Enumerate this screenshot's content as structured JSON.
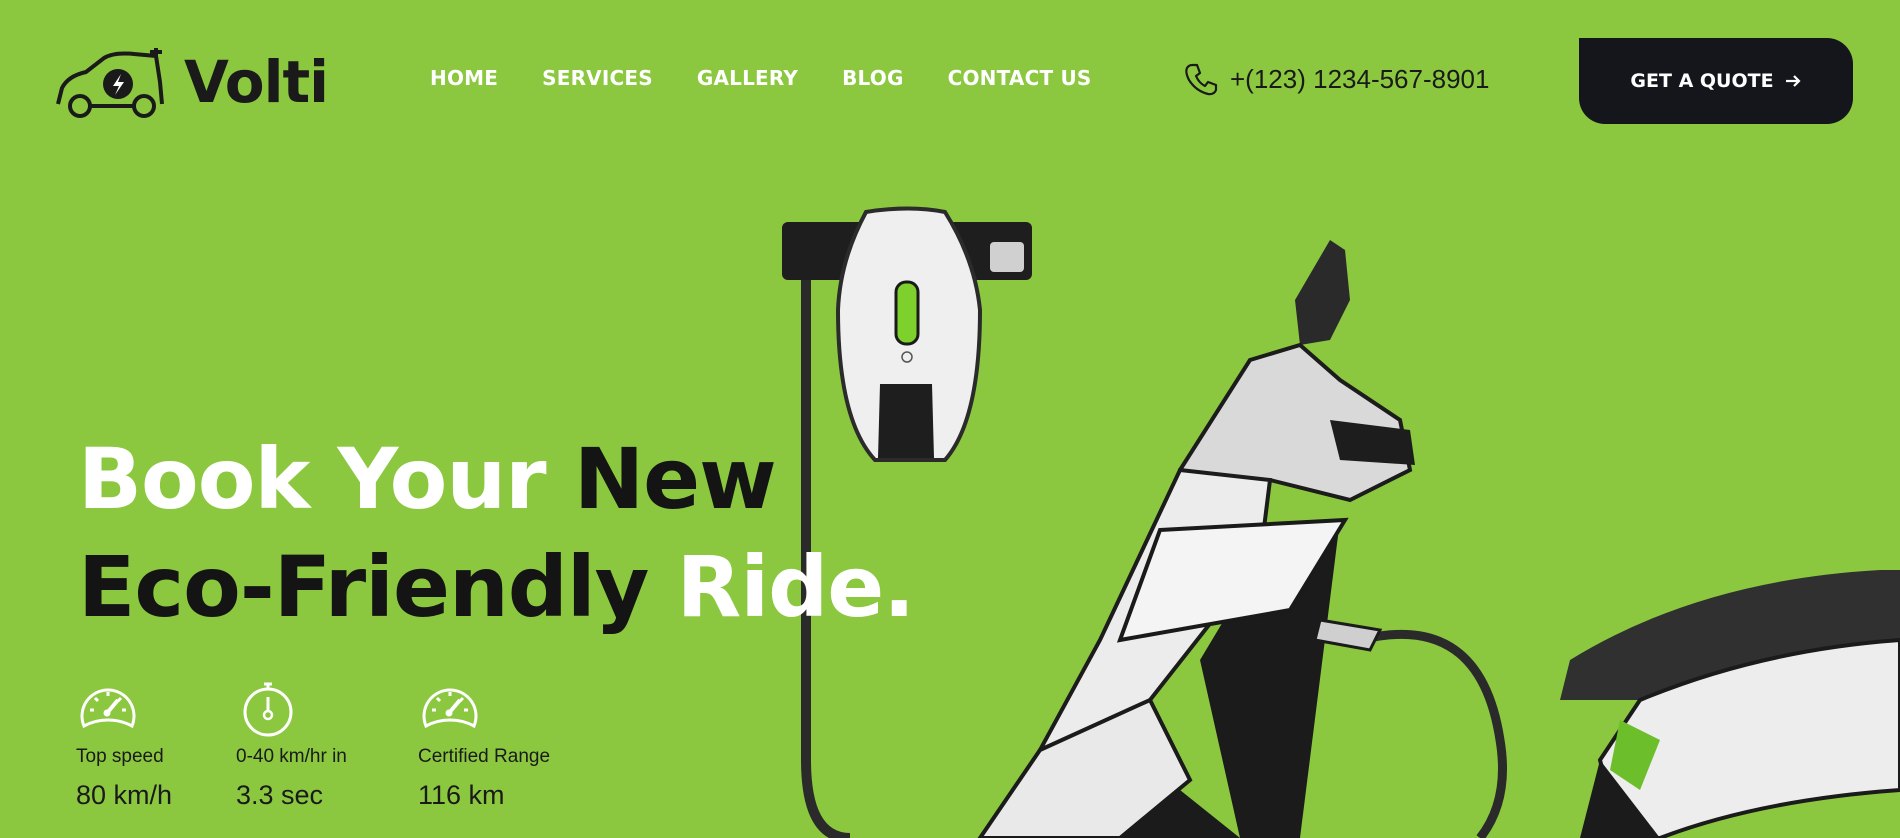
{
  "brand": {
    "name": "Volti",
    "logo_icon": "electric-car-icon"
  },
  "nav": {
    "items": [
      {
        "label": "HOME"
      },
      {
        "label": "SERVICES"
      },
      {
        "label": "GALLERY"
      },
      {
        "label": "BLOG"
      },
      {
        "label": "CONTACT US"
      }
    ]
  },
  "contact": {
    "phone": "+(123) 1234-567-8901",
    "icon": "phone-icon"
  },
  "cta": {
    "label": "GET A QUOTE",
    "icon": "arrow-right-icon"
  },
  "hero": {
    "line1_white": "Book Your ",
    "line1_dark": "New",
    "line2_dark": "Eco-Friendly ",
    "line2_white": "Ride."
  },
  "stats": [
    {
      "icon": "speedometer-icon",
      "label": "Top speed",
      "value": "80 km/h"
    },
    {
      "icon": "stopwatch-icon",
      "label": "0-40 km/hr in",
      "value": "3.3 sec"
    },
    {
      "icon": "speedometer-icon",
      "label": "Certified Range",
      "value": "116 km"
    }
  ],
  "colors": {
    "background": "#8bc83f",
    "dark": "#15161b",
    "white": "#ffffff"
  }
}
